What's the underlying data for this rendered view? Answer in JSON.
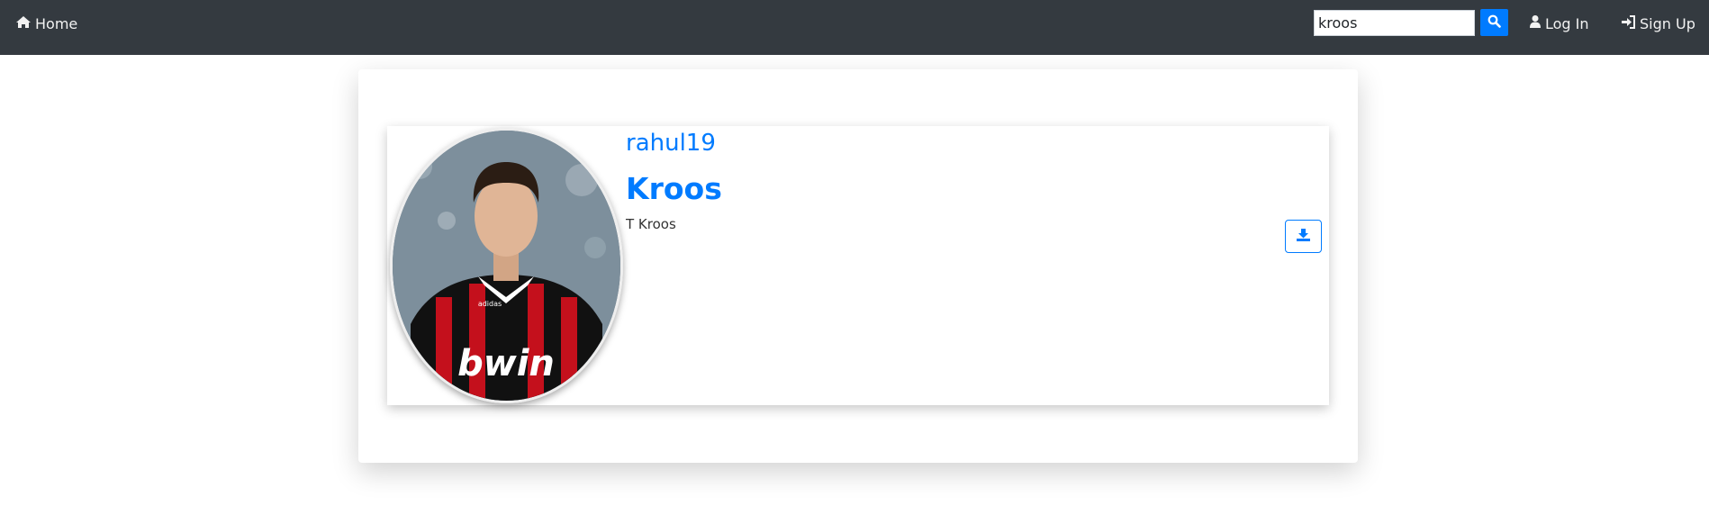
{
  "navbar": {
    "home_label": "Home",
    "search": {
      "value": "kroos",
      "placeholder": ""
    },
    "login_label": "Log In",
    "signup_label": "Sign Up"
  },
  "profile": {
    "username": "rahul19",
    "title": "Kroos",
    "description": "T Kroos",
    "avatar_alt": "profile photo"
  },
  "icons": {
    "home": "home-icon",
    "search": "search-icon",
    "login": "user-icon",
    "signup": "sign-in-icon",
    "download": "download-icon"
  },
  "colors": {
    "navbar_bg": "#343a40",
    "accent": "#007bff",
    "nav_text": "#f2f2f2"
  }
}
